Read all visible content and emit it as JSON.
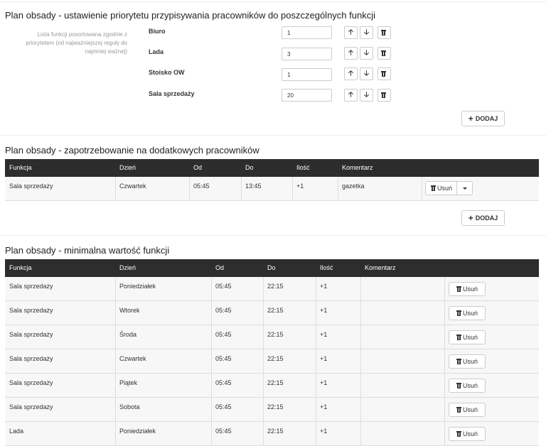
{
  "priority": {
    "title": "Plan obsady - ustawienie priorytetu przypisywania pracowników do poszczególnych funkcji",
    "hint": "Lista funkcji posortowana zgodnie z priorytetem (od najważniejszej reguły do najmniej ważnej)",
    "items": [
      {
        "label": "Biuro",
        "value": "1"
      },
      {
        "label": "Lada",
        "value": "3"
      },
      {
        "label": "Stoisko OW",
        "value": "1"
      },
      {
        "label": "Sala sprzedaży",
        "value": "20"
      }
    ],
    "add_label": "DODAJ"
  },
  "extra": {
    "title": "Plan obsady - zapotrzebowanie na dodatkowych pracowników",
    "columns": [
      "Funkcja",
      "Dzień",
      "Od",
      "Do",
      "Ilość",
      "Komentarz"
    ],
    "rows": [
      {
        "funkcja": "Sala sprzedaży",
        "dzien": "Czwartek",
        "od": "05:45",
        "do": "13:45",
        "ilosc": "+1",
        "komentarz": "gazetka"
      }
    ],
    "delete_label": "Usuń",
    "add_label": "DODAJ"
  },
  "minimum": {
    "title": "Plan obsady - minimalna wartość funkcji",
    "columns": [
      "Funkcja",
      "Dzień",
      "Od",
      "Do",
      "Ilość",
      "Komentarz"
    ],
    "rows": [
      {
        "funkcja": "Sala sprzedaży",
        "dzien": "Poniedziałek",
        "od": "05:45",
        "do": "22:15",
        "ilosc": "+1",
        "komentarz": ""
      },
      {
        "funkcja": "Sala sprzedaży",
        "dzien": "Wtorek",
        "od": "05:45",
        "do": "22:15",
        "ilosc": "+1",
        "komentarz": ""
      },
      {
        "funkcja": "Sala sprzedaży",
        "dzien": "Środa",
        "od": "05:45",
        "do": "22:15",
        "ilosc": "+1",
        "komentarz": ""
      },
      {
        "funkcja": "Sala sprzedaży",
        "dzien": "Czwartek",
        "od": "05:45",
        "do": "22:15",
        "ilosc": "+1",
        "komentarz": ""
      },
      {
        "funkcja": "Sala sprzedaży",
        "dzien": "Piątek",
        "od": "05:45",
        "do": "22:15",
        "ilosc": "+1",
        "komentarz": ""
      },
      {
        "funkcja": "Sala sprzedaży",
        "dzien": "Sobota",
        "od": "05:45",
        "do": "22:15",
        "ilosc": "+1",
        "komentarz": ""
      },
      {
        "funkcja": "Lada",
        "dzien": "Poniedziałek",
        "od": "05:45",
        "do": "22:15",
        "ilosc": "+1",
        "komentarz": ""
      }
    ],
    "delete_label": "Usuń"
  }
}
